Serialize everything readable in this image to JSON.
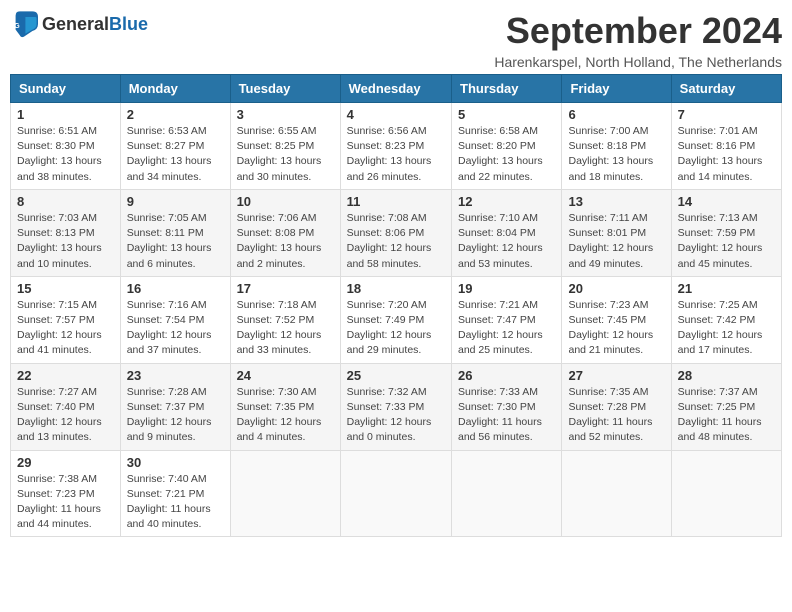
{
  "header": {
    "logo_general": "General",
    "logo_blue": "Blue",
    "month_year": "September 2024",
    "location": "Harenkarspel, North Holland, The Netherlands"
  },
  "days_of_week": [
    "Sunday",
    "Monday",
    "Tuesday",
    "Wednesday",
    "Thursday",
    "Friday",
    "Saturday"
  ],
  "weeks": [
    [
      {
        "day": "1",
        "sunrise": "6:51 AM",
        "sunset": "8:30 PM",
        "daylight": "13 hours and 38 minutes."
      },
      {
        "day": "2",
        "sunrise": "6:53 AM",
        "sunset": "8:27 PM",
        "daylight": "13 hours and 34 minutes."
      },
      {
        "day": "3",
        "sunrise": "6:55 AM",
        "sunset": "8:25 PM",
        "daylight": "13 hours and 30 minutes."
      },
      {
        "day": "4",
        "sunrise": "6:56 AM",
        "sunset": "8:23 PM",
        "daylight": "13 hours and 26 minutes."
      },
      {
        "day": "5",
        "sunrise": "6:58 AM",
        "sunset": "8:20 PM",
        "daylight": "13 hours and 22 minutes."
      },
      {
        "day": "6",
        "sunrise": "7:00 AM",
        "sunset": "8:18 PM",
        "daylight": "13 hours and 18 minutes."
      },
      {
        "day": "7",
        "sunrise": "7:01 AM",
        "sunset": "8:16 PM",
        "daylight": "13 hours and 14 minutes."
      }
    ],
    [
      {
        "day": "8",
        "sunrise": "7:03 AM",
        "sunset": "8:13 PM",
        "daylight": "13 hours and 10 minutes."
      },
      {
        "day": "9",
        "sunrise": "7:05 AM",
        "sunset": "8:11 PM",
        "daylight": "13 hours and 6 minutes."
      },
      {
        "day": "10",
        "sunrise": "7:06 AM",
        "sunset": "8:08 PM",
        "daylight": "13 hours and 2 minutes."
      },
      {
        "day": "11",
        "sunrise": "7:08 AM",
        "sunset": "8:06 PM",
        "daylight": "12 hours and 58 minutes."
      },
      {
        "day": "12",
        "sunrise": "7:10 AM",
        "sunset": "8:04 PM",
        "daylight": "12 hours and 53 minutes."
      },
      {
        "day": "13",
        "sunrise": "7:11 AM",
        "sunset": "8:01 PM",
        "daylight": "12 hours and 49 minutes."
      },
      {
        "day": "14",
        "sunrise": "7:13 AM",
        "sunset": "7:59 PM",
        "daylight": "12 hours and 45 minutes."
      }
    ],
    [
      {
        "day": "15",
        "sunrise": "7:15 AM",
        "sunset": "7:57 PM",
        "daylight": "12 hours and 41 minutes."
      },
      {
        "day": "16",
        "sunrise": "7:16 AM",
        "sunset": "7:54 PM",
        "daylight": "12 hours and 37 minutes."
      },
      {
        "day": "17",
        "sunrise": "7:18 AM",
        "sunset": "7:52 PM",
        "daylight": "12 hours and 33 minutes."
      },
      {
        "day": "18",
        "sunrise": "7:20 AM",
        "sunset": "7:49 PM",
        "daylight": "12 hours and 29 minutes."
      },
      {
        "day": "19",
        "sunrise": "7:21 AM",
        "sunset": "7:47 PM",
        "daylight": "12 hours and 25 minutes."
      },
      {
        "day": "20",
        "sunrise": "7:23 AM",
        "sunset": "7:45 PM",
        "daylight": "12 hours and 21 minutes."
      },
      {
        "day": "21",
        "sunrise": "7:25 AM",
        "sunset": "7:42 PM",
        "daylight": "12 hours and 17 minutes."
      }
    ],
    [
      {
        "day": "22",
        "sunrise": "7:27 AM",
        "sunset": "7:40 PM",
        "daylight": "12 hours and 13 minutes."
      },
      {
        "day": "23",
        "sunrise": "7:28 AM",
        "sunset": "7:37 PM",
        "daylight": "12 hours and 9 minutes."
      },
      {
        "day": "24",
        "sunrise": "7:30 AM",
        "sunset": "7:35 PM",
        "daylight": "12 hours and 4 minutes."
      },
      {
        "day": "25",
        "sunrise": "7:32 AM",
        "sunset": "7:33 PM",
        "daylight": "12 hours and 0 minutes."
      },
      {
        "day": "26",
        "sunrise": "7:33 AM",
        "sunset": "7:30 PM",
        "daylight": "11 hours and 56 minutes."
      },
      {
        "day": "27",
        "sunrise": "7:35 AM",
        "sunset": "7:28 PM",
        "daylight": "11 hours and 52 minutes."
      },
      {
        "day": "28",
        "sunrise": "7:37 AM",
        "sunset": "7:25 PM",
        "daylight": "11 hours and 48 minutes."
      }
    ],
    [
      {
        "day": "29",
        "sunrise": "7:38 AM",
        "sunset": "7:23 PM",
        "daylight": "11 hours and 44 minutes."
      },
      {
        "day": "30",
        "sunrise": "7:40 AM",
        "sunset": "7:21 PM",
        "daylight": "11 hours and 40 minutes."
      },
      null,
      null,
      null,
      null,
      null
    ]
  ]
}
